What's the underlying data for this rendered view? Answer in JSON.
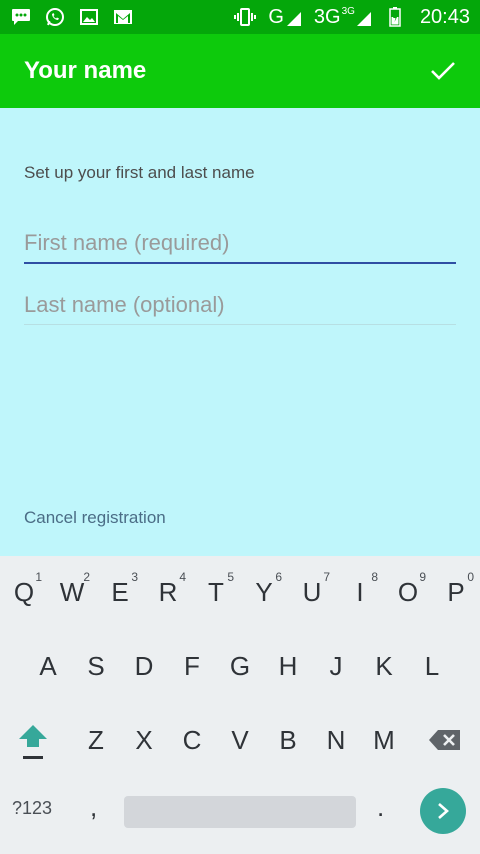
{
  "status_bar": {
    "network_g": "G",
    "network_3g": "3G",
    "network_3g_sup": "3G",
    "time": "20:43",
    "icons": [
      "messaging-icon",
      "whatsapp-icon",
      "gallery-icon",
      "gmail-icon",
      "vibrate-icon",
      "signal-icon",
      "signal-icon",
      "battery-charging-icon"
    ]
  },
  "app_bar": {
    "title": "Your name",
    "done_icon": "check-icon"
  },
  "form": {
    "subtitle": "Set up your first and last name",
    "first_name_placeholder": "First name (required)",
    "first_name_value": "",
    "last_name_placeholder": "Last name (optional)",
    "last_name_value": "",
    "cancel_label": "Cancel registration"
  },
  "keyboard": {
    "row1": [
      {
        "label": "Q",
        "hint": "1"
      },
      {
        "label": "W",
        "hint": "2"
      },
      {
        "label": "E",
        "hint": "3"
      },
      {
        "label": "R",
        "hint": "4"
      },
      {
        "label": "T",
        "hint": "5"
      },
      {
        "label": "Y",
        "hint": "6"
      },
      {
        "label": "U",
        "hint": "7"
      },
      {
        "label": "I",
        "hint": "8"
      },
      {
        "label": "O",
        "hint": "9"
      },
      {
        "label": "P",
        "hint": "0"
      }
    ],
    "row2": [
      "A",
      "S",
      "D",
      "F",
      "G",
      "H",
      "J",
      "K",
      "L"
    ],
    "row3": [
      "Z",
      "X",
      "C",
      "V",
      "B",
      "N",
      "M"
    ],
    "symbols_label": "?123",
    "comma_label": ",",
    "period_label": ".",
    "colors": {
      "accent": "#36a89a",
      "app_bar": "#0dca0c",
      "status_bar": "#04a70a",
      "background": "#bff6fb"
    }
  }
}
